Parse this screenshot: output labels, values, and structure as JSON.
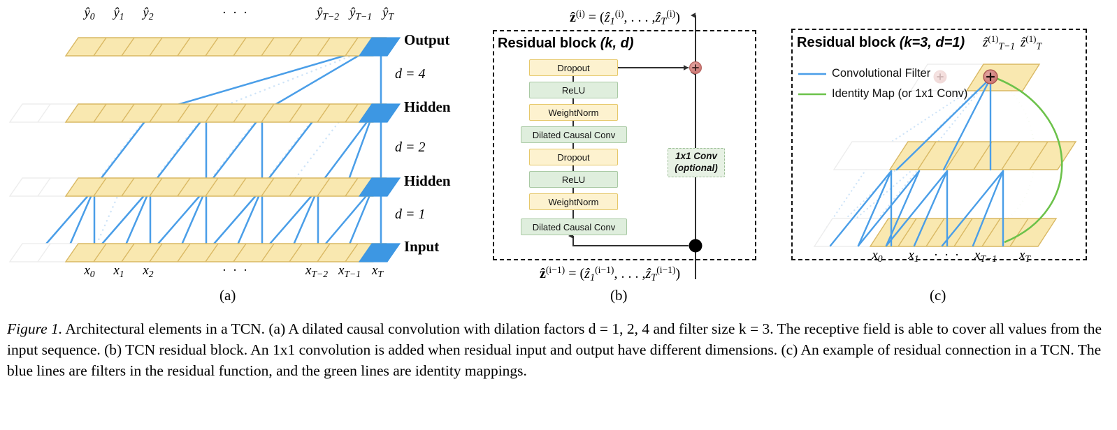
{
  "figure": {
    "caption_lead": "Figure 1.",
    "caption_body": " Architectural elements in a TCN. (a) A dilated causal convolution with dilation factors d = 1, 2, 4 and filter size k = 3. The receptive field is able to cover all values from the input sequence. (b) TCN residual block. An 1x1 convolution is added when residual input and output have different dimensions. (c) An example of residual connection in a TCN. The blue lines are filters in the residual function, and the green lines are identity mappings.",
    "subcaptions": {
      "a": "(a)",
      "b": "(b)",
      "c": "(c)"
    }
  },
  "colors": {
    "cell_fill": "#f9e8b0",
    "cell_stroke": "#d9b863",
    "cell_empty_fill": "#ffffff",
    "cell_empty_stroke": "#e8e8e8",
    "highlight_blue": "#3d97e3",
    "filter_blue": "#4a9ee8",
    "filter_blue_faint": "#cfe4f8",
    "identity_green": "#6cc24a",
    "identity_green_faint": "#d8eecb",
    "box_yellow": "#fdf2cf",
    "box_yellow_border": "#e6c86a",
    "box_green": "#dfeedd",
    "box_green_border": "#a9c9a4",
    "add_node_red": "#d8827e",
    "arrow_gray": "#3a3a3a"
  },
  "panel_a": {
    "row_labels": [
      "Output",
      "Hidden",
      "Hidden",
      "Input"
    ],
    "dilation_labels": [
      "d = 4",
      "d = 2",
      "d = 1"
    ],
    "dilation_values": [
      4,
      2,
      1
    ],
    "top_ticks": [
      {
        "base": "ŷ",
        "sub": "0"
      },
      {
        "base": "ŷ",
        "sub": "1"
      },
      {
        "base": "ŷ",
        "sub": "2"
      },
      {
        "base": "· · ·",
        "sub": ""
      },
      {
        "base": "ŷ",
        "sub": "T−2"
      },
      {
        "base": "ŷ",
        "sub": "T−1"
      },
      {
        "base": "ŷ",
        "sub": "T"
      }
    ],
    "bottom_ticks": [
      {
        "base": "x",
        "sub": "0"
      },
      {
        "base": "x",
        "sub": "1"
      },
      {
        "base": "x",
        "sub": "2"
      },
      {
        "base": "· · ·",
        "sub": ""
      },
      {
        "base": "x",
        "sub": "T−2"
      },
      {
        "base": "x",
        "sub": "T−1"
      },
      {
        "base": "x",
        "sub": "T"
      }
    ],
    "cells_per_row": 11,
    "empty_cells_per_row": [
      0,
      2,
      2,
      2
    ],
    "filter_size": 3
  },
  "panel_b": {
    "title_main": "Residual block ",
    "title_params": "(k, d)",
    "top_equation": {
      "lhs": "ẑ",
      "lhs_sup": "(i)",
      "rhs_first": "ẑ",
      "rhs_first_sub": "1",
      "rhs_first_sup": "(i)",
      "rhs_last": "ẑ",
      "rhs_last_sub": "T",
      "rhs_last_sup": "(i)"
    },
    "bottom_equation": {
      "lhs": "ẑ",
      "lhs_sup": "(i−1)",
      "rhs_first": "ẑ",
      "rhs_first_sub": "1",
      "rhs_first_sup": "(i−1)",
      "rhs_last": "ẑ",
      "rhs_last_sub": "T",
      "rhs_last_sup": "(i−1)"
    },
    "stack": [
      {
        "label": "Dropout",
        "style": "yellow"
      },
      {
        "label": "ReLU",
        "style": "green"
      },
      {
        "label": "WeightNorm",
        "style": "yellow"
      },
      {
        "label": "Dilated Causal Conv",
        "style": "green"
      },
      {
        "label": "Dropout",
        "style": "yellow"
      },
      {
        "label": "ReLU",
        "style": "green"
      },
      {
        "label": "WeightNorm",
        "style": "yellow"
      },
      {
        "label": "Dilated Causal Conv",
        "style": "green"
      }
    ],
    "side_box_line1": "1x1 Conv",
    "side_box_line2": "(optional)",
    "add_symbol": "+"
  },
  "panel_c": {
    "title_main": "Residual block ",
    "title_params": "(k=3, d=1)",
    "legend": [
      {
        "label": "Convolutional Filter",
        "color": "#4a9ee8"
      },
      {
        "label": "Identity Map (or 1x1 Conv)",
        "color": "#6cc24a"
      }
    ],
    "output_ticks": [
      {
        "base": "ẑ",
        "sub": "T−1",
        "sup": "(1)"
      },
      {
        "base": "ẑ",
        "sub": "T",
        "sup": "(1)"
      }
    ],
    "bottom_ticks": [
      {
        "base": "x",
        "sub": "0"
      },
      {
        "base": "x",
        "sub": "1"
      },
      {
        "base": "· · ·",
        "sub": ""
      },
      {
        "base": "x",
        "sub": "T−1"
      },
      {
        "base": "x",
        "sub": "T"
      }
    ],
    "add_symbol": "+",
    "layers": 3,
    "cells_per_row": 6
  }
}
